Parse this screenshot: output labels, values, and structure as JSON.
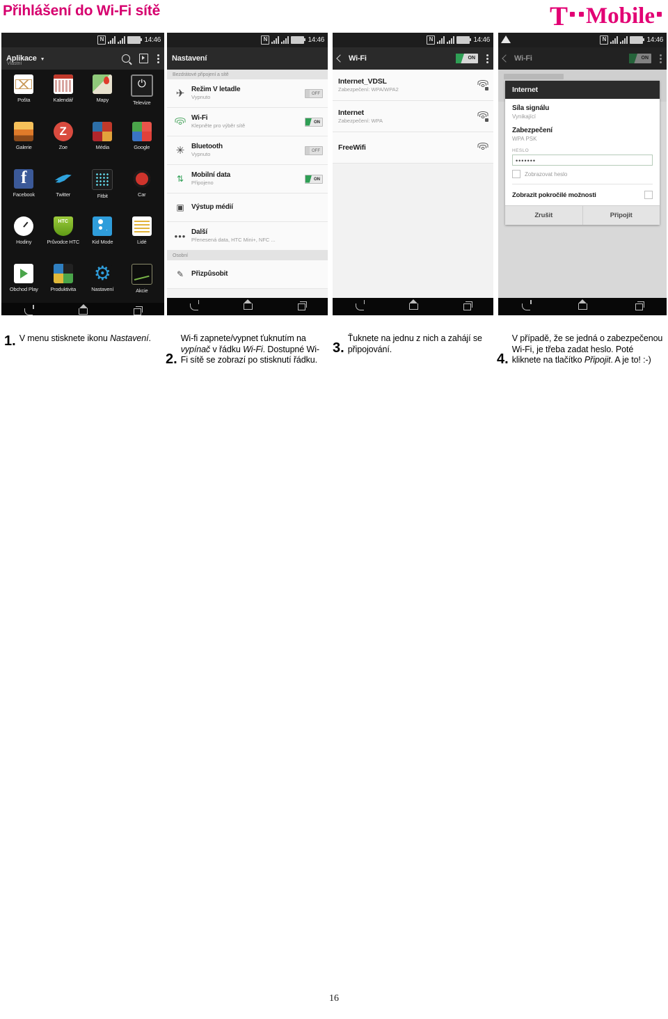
{
  "header": {
    "title": "Přihlášení do Wi-Fi sítě",
    "logo_letter": "T",
    "logo_word": "Mobile",
    "brand_color": "#e20074"
  },
  "status_bar": {
    "time": "14:46",
    "nfc_label": "N",
    "icons": [
      "nfc-icon",
      "mobile-network-icon",
      "signal-bars-icon",
      "battery-icon"
    ]
  },
  "screens": [
    {
      "id": "app-drawer",
      "appbar": {
        "title": "Aplikace",
        "subtitle": "Vlastní",
        "actions": [
          "search-icon",
          "play-store-icon",
          "overflow-menu-icon"
        ]
      },
      "apps": [
        {
          "label": "Pošta",
          "icon": "mail-icon"
        },
        {
          "label": "Kalendář",
          "icon": "calendar-icon"
        },
        {
          "label": "Mapy",
          "icon": "maps-icon"
        },
        {
          "label": "Televize",
          "icon": "tv-remote-icon"
        },
        {
          "label": "Galerie",
          "icon": "gallery-icon"
        },
        {
          "label": "Zoe",
          "icon": "zoe-icon"
        },
        {
          "label": "Média",
          "icon": "media-folder-icon"
        },
        {
          "label": "Google",
          "icon": "google-folder-icon"
        },
        {
          "label": "Facebook",
          "icon": "facebook-icon"
        },
        {
          "label": "Twitter",
          "icon": "twitter-icon"
        },
        {
          "label": "Fitbit",
          "icon": "fitbit-icon"
        },
        {
          "label": "Car",
          "icon": "car-icon"
        },
        {
          "label": "Hodiny",
          "icon": "clock-icon"
        },
        {
          "label": "Průvodce HTC",
          "icon": "htc-guide-icon"
        },
        {
          "label": "Kid Mode",
          "icon": "kid-mode-icon"
        },
        {
          "label": "Lidé",
          "icon": "people-icon"
        },
        {
          "label": "Obchod Play",
          "icon": "play-store-icon"
        },
        {
          "label": "Produktivita",
          "icon": "productivity-folder-icon"
        },
        {
          "label": "Nastavení",
          "icon": "gear-icon"
        },
        {
          "label": "Akcie",
          "icon": "stocks-icon"
        }
      ]
    },
    {
      "id": "settings",
      "appbar": {
        "title": "Nastavení"
      },
      "group_wireless": "Bezdrátové připojení a sítě",
      "group_personal": "Osobní",
      "rows": [
        {
          "title": "Režim V letadle",
          "sub": "Vypnuto",
          "icon": "airplane-icon",
          "toggle": "OFF"
        },
        {
          "title": "Wi-Fi",
          "sub": "Klepněte pro výběr sítě",
          "icon": "wifi-icon",
          "toggle": "ON"
        },
        {
          "title": "Bluetooth",
          "sub": "Vypnuto",
          "icon": "bluetooth-icon",
          "toggle": "OFF"
        },
        {
          "title": "Mobilní data",
          "sub": "Připojeno",
          "icon": "data-arrows-icon",
          "toggle": "ON"
        },
        {
          "title": "Výstup médií",
          "sub": "",
          "icon": "media-output-icon",
          "toggle": ""
        },
        {
          "title": "Další",
          "sub": "Přenesená data, HTC Mini+, NFC ...",
          "icon": "ellipsis-icon",
          "toggle": ""
        }
      ],
      "personal_row": {
        "title": "Přizpůsobit",
        "icon": "personalize-icon"
      }
    },
    {
      "id": "wifi-list",
      "appbar": {
        "title": "Wi-Fi",
        "toggle": "ON",
        "back": "back-arrow-icon",
        "menu": "overflow-menu-icon"
      },
      "networks": [
        {
          "ssid": "Internet_VDSL",
          "security": "Zabezpečení: WPA/WPA2",
          "icon": "wifi-secured-icon"
        },
        {
          "ssid": "Internet",
          "security": "Zabezpečení: WPA",
          "icon": "wifi-secured-icon"
        },
        {
          "ssid": "FreeWifi",
          "security": "",
          "icon": "wifi-open-icon"
        }
      ]
    },
    {
      "id": "wifi-password-dialog",
      "appbar": {
        "title": "Wi-Fi",
        "toggle": "ON"
      },
      "dialog": {
        "title": "Internet",
        "signal_label": "Síla signálu",
        "signal_value": "Vynikající",
        "security_label": "Zabezpečení",
        "security_value": "WPA PSK",
        "password_caption": "HESLO",
        "password_value": "•••••••",
        "show_password_label": "Zobrazovat heslo",
        "advanced_label": "Zobrazit pokročilé možnosti",
        "cancel_button": "Zrušit",
        "connect_button": "Připojit"
      }
    }
  ],
  "captions": [
    {
      "num": "1.",
      "parts": [
        {
          "t": "V menu stisknete ikonu ",
          "i": false
        },
        {
          "t": "Nastavení",
          "i": true
        },
        {
          "t": ".",
          "i": false
        }
      ]
    },
    {
      "num": "2.",
      "parts": [
        {
          "t": "Wi-fi zapnete/vypnet ťuknutím na ",
          "i": false
        },
        {
          "t": "vypínač",
          "i": true
        },
        {
          "t": " v řádku ",
          "i": false
        },
        {
          "t": "Wi-Fi",
          "i": true
        },
        {
          "t": ". Dostupné Wi-Fi sítě se zobrazí po stisknutí řádku.",
          "i": false
        }
      ]
    },
    {
      "num": "3.",
      "parts": [
        {
          "t": "Ťuknete na jednu z nich a zahájí se připojování.",
          "i": false
        }
      ]
    },
    {
      "num": "4.",
      "parts": [
        {
          "t": "V případě, že se jedná o zabezpečenou Wi-Fi, je třeba zadat heslo. Poté kliknete na tlačítko ",
          "i": false
        },
        {
          "t": "Připojit",
          "i": true
        },
        {
          "t": ". A je to!  :-)",
          "i": false
        }
      ]
    }
  ],
  "footer": {
    "page_number": "16"
  }
}
